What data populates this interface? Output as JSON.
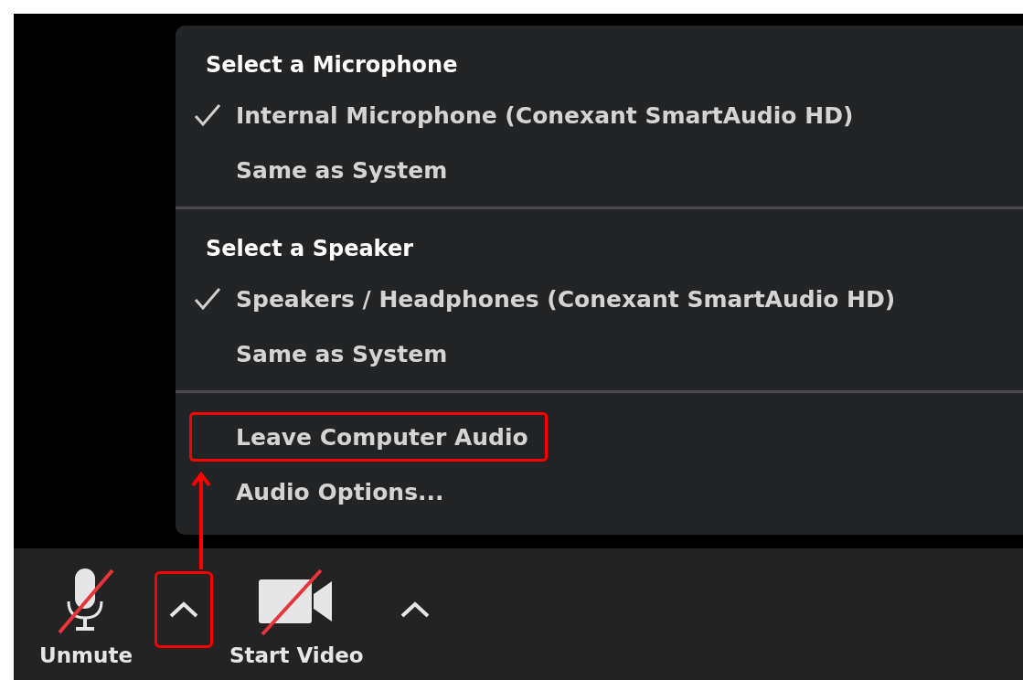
{
  "audio_menu": {
    "sections": [
      {
        "heading": "Select a Microphone",
        "items": [
          {
            "label": "Internal Microphone (Conexant SmartAudio HD)",
            "checked": true,
            "highlighted": false
          },
          {
            "label": "Same as System",
            "checked": false,
            "highlighted": false
          }
        ]
      },
      {
        "heading": "Select a Speaker",
        "items": [
          {
            "label": "Speakers / Headphones (Conexant SmartAudio HD)",
            "checked": true,
            "highlighted": false
          },
          {
            "label": "Same as System",
            "checked": false,
            "highlighted": false
          }
        ]
      },
      {
        "items": [
          {
            "label": "Leave Computer Audio",
            "checked": false,
            "highlighted": true
          },
          {
            "label": "Audio Options...",
            "checked": false,
            "highlighted": false
          }
        ]
      }
    ]
  },
  "toolbar": {
    "buttons": [
      {
        "kind": "mic",
        "label": "Unmute",
        "muted": true
      },
      {
        "kind": "caret",
        "highlighted": true
      },
      {
        "kind": "video",
        "label": "Start Video",
        "muted": true
      },
      {
        "kind": "caret",
        "highlighted": false
      }
    ]
  }
}
